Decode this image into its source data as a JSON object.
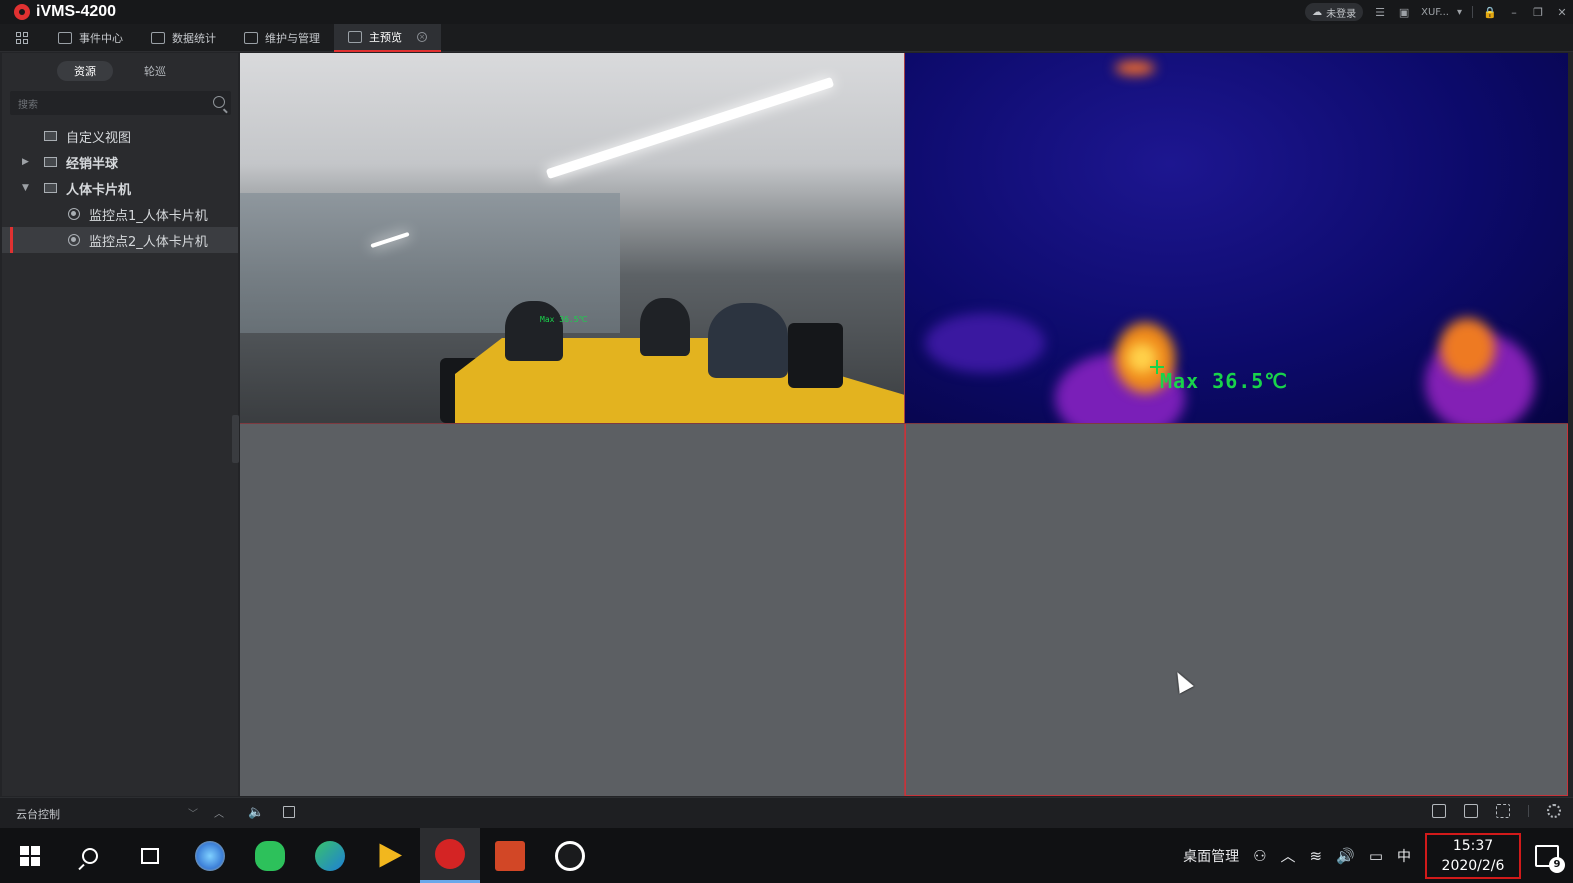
{
  "window": {
    "title": "iVMS-4200",
    "cloud_status": "未登录",
    "user": "XUF..."
  },
  "menu": {
    "items": [
      {
        "label": "事件中心",
        "icon": "event-center-icon"
      },
      {
        "label": "数据统计",
        "icon": "statistics-icon"
      },
      {
        "label": "维护与管理",
        "icon": "maintenance-icon"
      },
      {
        "label": "主预览",
        "icon": "main-preview-icon",
        "active": true
      }
    ]
  },
  "sidebar": {
    "tabs": [
      {
        "label": "资源",
        "active": true
      },
      {
        "label": "轮巡",
        "active": false
      }
    ],
    "search_placeholder": "搜索",
    "tree": [
      {
        "label": "自定义视图",
        "icon": "custom-view-icon",
        "level": 0
      },
      {
        "label": "经销半球",
        "icon": "folder-icon",
        "level": 0,
        "expander": "collapsed"
      },
      {
        "label": "人体卡片机",
        "icon": "folder-icon",
        "level": 0,
        "expander": "expanded"
      },
      {
        "label": "监控点1_人体卡片机",
        "icon": "camera-icon",
        "level": 1
      },
      {
        "label": "监控点2_人体卡片机",
        "icon": "camera-icon",
        "level": 1,
        "selected": true
      }
    ]
  },
  "video": {
    "thermal_readout": "Max 36.5℃",
    "visible_overlay": "Max 36.5℃"
  },
  "controls": {
    "ptz_label": "云台控制"
  },
  "taskbar": {
    "desktop_manager": "桌面管理",
    "ime": "中",
    "time": "15:37",
    "date": "2020/2/6",
    "notifications": "9"
  },
  "colors": {
    "accent": "#e03131",
    "thermal_text": "#19d34b",
    "table_yellow": "#e3b31f"
  }
}
